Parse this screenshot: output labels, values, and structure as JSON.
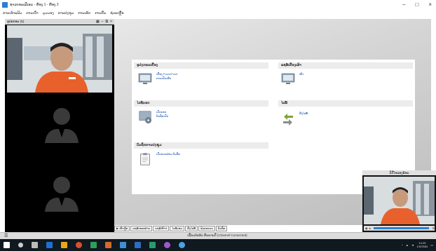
{
  "window": {
    "title": "ຊາວຄອນເຟີເຣນ - ຫ້ອງ 1 - ຫ້ອງ 2"
  },
  "menu": [
    {
      "label": "ການເອົາແຟ້ມ"
    },
    {
      "label": "ການເຂົ້າ"
    },
    {
      "label": "ມຸມມອງ"
    },
    {
      "label": "ການປະຊຸມ"
    },
    {
      "label": "ການເຮັດ"
    },
    {
      "label": "ການຄົ້ນ"
    },
    {
      "label": "ຊ່ວຍເຫຼືອ"
    }
  ],
  "left_panel": {
    "title": "ອຸປະກອນ (5)"
  },
  "sections": {
    "devices": {
      "heading": "ອຸປະກອນເຄື່ອງ",
      "item_line1": "ເຄື່ອງ PowerPoint",
      "item_line2": "ການເປີດເຜີຍ"
    },
    "local_share": {
      "heading": "ແຊຣ໌ເຄື່ອງເຮົາ",
      "item_line1": "ໜ້າ"
    },
    "whiteboard": {
      "heading": "ໄວທ໌ບອດ",
      "item_line1": "ເປີດບອດ",
      "item_line2": "ບັນທຶກເປີດ"
    },
    "files": {
      "heading": "ໄຟລ໌",
      "item_line1": "ສົ່ງໄຟລ໌"
    },
    "meeting_notes": {
      "heading": "ບັນທຶກການປະຊຸມ",
      "item_line1": "ເປີດແບບຟອມ ບັນທຶກ"
    }
  },
  "tabs": [
    {
      "label": "▶ ໜ້າຫຼັກ"
    },
    {
      "label": "ແຊຣ໌ເອກະສານ"
    },
    {
      "label": "ແຊຣ໌ໜ້າຈໍ"
    },
    {
      "label": "ໄວທ໌ບອດ"
    },
    {
      "label": "ສົ່ງໄຟລ໌"
    },
    {
      "label": "ລົງຄະແນນ"
    },
    {
      "label": "ບັນທຶກ"
    }
  ],
  "status": {
    "text": "ເຊື່ອມຕໍ່ແລ້ວ ສັນຍານດີ (Channel Connected)"
  },
  "pip": {
    "title": "ວິດີໂອຂອງຂ້ອຍ"
  },
  "taskbar": {
    "time": "14:25",
    "date": "1/9/2564"
  },
  "colors": {
    "accent": "#2a7fd4",
    "taskbar": "#101820",
    "shirt": "#e8612c"
  }
}
